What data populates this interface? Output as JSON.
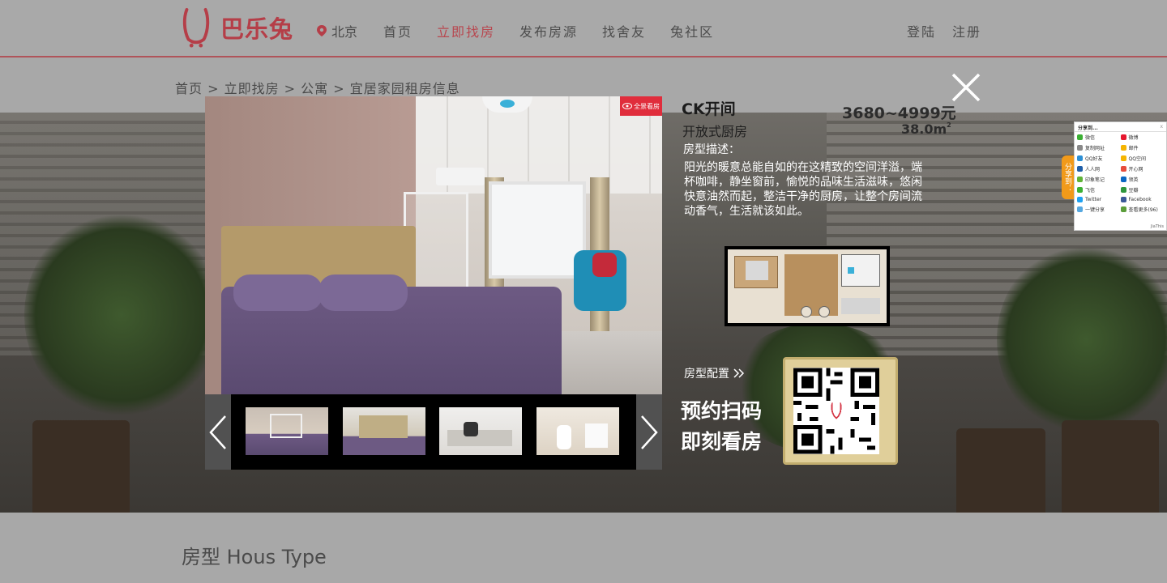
{
  "header": {
    "logo_text": "巴乐兔",
    "city": "北京",
    "nav": [
      "首页",
      "立即找房",
      "发布房源",
      "找舍友",
      "兔社区"
    ],
    "active_nav": "立即找房",
    "login": "登陆",
    "register": "注册"
  },
  "breadcrumb": "首页 > 立即找房 > 公寓 > 宜居家园租房信息",
  "modal": {
    "vr_badge": "全景看房",
    "title": "CK开间",
    "price": "3680~4999元",
    "subtitle": "开放式厨房",
    "area_value": "38.0m",
    "area_unit_sup": "2",
    "desc_label": "房型描述：",
    "desc_text": "阳光的暖意总能自如的在这精致的空间洋溢，端杯咖啡，静坐窗前，愉悦的品味生活滋味，悠闲快意油然而起，整洁干净的厨房，让整个房间流动香气，生活就该如此。",
    "config_label": "房型配置",
    "qr_line1": "预约扫码",
    "qr_line2": "即刻看房"
  },
  "share": {
    "title": "分享到...",
    "close": "x",
    "tab": "分享到：",
    "items": [
      {
        "label": "微信",
        "color": "#3cb034"
      },
      {
        "label": "微博",
        "color": "#e6162d"
      },
      {
        "label": "复制网址",
        "color": "#888888"
      },
      {
        "label": "邮件",
        "color": "#f5b400"
      },
      {
        "label": "QQ好友",
        "color": "#2c8fd4"
      },
      {
        "label": "QQ空间",
        "color": "#f5b400"
      },
      {
        "label": "人人网",
        "color": "#1f5ea8"
      },
      {
        "label": "开心网",
        "color": "#e74c3c"
      },
      {
        "label": "印象笔记",
        "color": "#5fb336"
      },
      {
        "label": "领英",
        "color": "#0a66c2"
      },
      {
        "label": "飞信",
        "color": "#3cb034"
      },
      {
        "label": "豆瓣",
        "color": "#2e963d"
      },
      {
        "label": "Twitter",
        "color": "#1da1f2"
      },
      {
        "label": "Facebook",
        "color": "#3b5998"
      },
      {
        "label": "一键分享",
        "color": "#56a8e0"
      },
      {
        "label": "查看更多(96)",
        "color": "#5b9d3a"
      }
    ],
    "footer": "JiaThis"
  },
  "section_title": "房型 Hous Type",
  "colors": {
    "brand": "#b53e48",
    "badge": "#e02d3c"
  }
}
